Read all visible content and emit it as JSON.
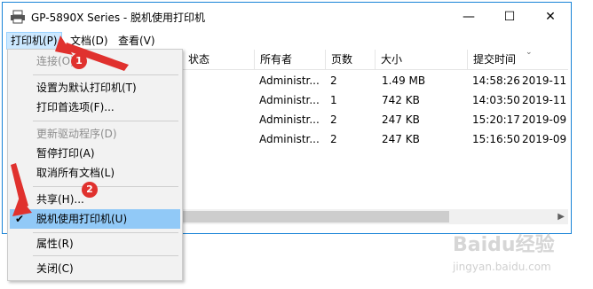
{
  "window": {
    "title": "GP-5890X Series - 脱机使用打印机"
  },
  "controls": {
    "minimize": "—",
    "maximize": "☐",
    "close": "✕"
  },
  "menubar": {
    "printer": "打印机(P)",
    "document": "文档(D)",
    "view": "查看(V)"
  },
  "columns": {
    "status": "状态",
    "owner": "所有者",
    "pages": "页数",
    "size": "大小",
    "submitted": "提交时间"
  },
  "rows": [
    {
      "owner": "Administr...",
      "pages": "2",
      "size": "1.49 MB",
      "time": "14:58:26",
      "date": "2019-11"
    },
    {
      "owner": "Administr...",
      "pages": "1",
      "size": "742 KB",
      "time": "14:03:50",
      "date": "2019-11"
    },
    {
      "owner": "Administr...",
      "pages": "2",
      "size": "247 KB",
      "time": "15:20:17",
      "date": "2019-09"
    },
    {
      "owner": "Administr...",
      "pages": "2",
      "size": "247 KB",
      "time": "15:16:50",
      "date": "2019-09"
    }
  ],
  "menu": {
    "connect": "连接(O)",
    "set_default": "设置为默认打印机(T)",
    "preferences": "打印首选项(F)...",
    "update_driver": "更新驱动程序(D)",
    "pause": "暂停打印(A)",
    "cancel_all": "取消所有文档(L)",
    "share": "共享(H)...",
    "offline": "脱机使用打印机(U)",
    "properties": "属性(R)",
    "close": "关闭(C)"
  },
  "badges": {
    "one": "1",
    "two": "2"
  },
  "watermark": {
    "line1": "Baidu经验",
    "line2": "jingyan.baidu.com"
  },
  "colors": {
    "accent": "#1883d7",
    "highlight": "#91c9f7",
    "badge": "#e0312e"
  }
}
